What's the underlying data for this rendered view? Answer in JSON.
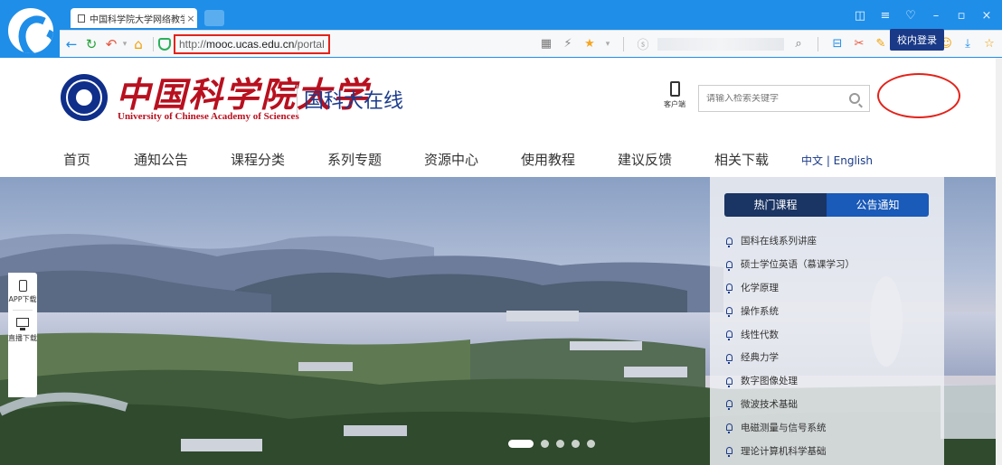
{
  "browser": {
    "tab_title": "中国科学院大学网络教学",
    "url_prefix": "http://",
    "url_domain": "mooc.ucas.edu.cn",
    "url_path": "/portal",
    "accent": "#1f8ee8",
    "highlight": "#e2231a"
  },
  "header": {
    "logo_cn": "中国科学院大学",
    "logo_en": "University of Chinese Academy of Sciences",
    "site_name": "国科大在线",
    "client_label": "客户端",
    "search_placeholder": "请输入检索关键字",
    "login_label": "校内登录"
  },
  "nav": {
    "items": [
      "首页",
      "通知公告",
      "课程分类",
      "系列专题",
      "资源中心",
      "使用教程",
      "建议反馈",
      "相关下载"
    ],
    "lang": "中文 | English"
  },
  "side": {
    "app_label": "APP下载",
    "live_label": "直播下载"
  },
  "panel": {
    "tabs": [
      "热门课程",
      "公告通知"
    ],
    "courses": [
      "国科在线系列讲座",
      "硕士学位英语（慕课学习）",
      "化学原理",
      "操作系统",
      "线性代数",
      "经典力学",
      "数字图像处理",
      "微波技术基础",
      "电磁测量与信号系统",
      "理论计算机科学基础"
    ]
  }
}
